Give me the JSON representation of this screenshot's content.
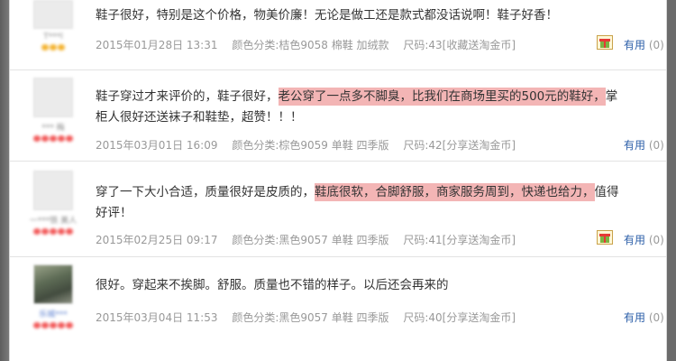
{
  "reviews": [
    {
      "text_parts": [
        "鞋子很好，特别是这个价格，物美价廉！无论是做工还是款式都没话说啊！鞋子好香！"
      ],
      "date": "2015年01月28日 13:31",
      "color": "颜色分类:桔色9058 棉鞋 加绒款",
      "size": "尺码:43[收藏送淘金币]",
      "useful_label": "有用",
      "useful_count": "(0)",
      "has_gift": true
    },
    {
      "text_parts": [
        "鞋子穿过才来评价的，鞋子很好，",
        "老公穿了一点多不脚臭，比我们在商场里买的500元的鞋好，",
        "掌柜人很好还送袜子和鞋垫，超赞！！！"
      ],
      "date": "2015年03月01日 16:09",
      "color": "颜色分类:棕色9059 单鞋 四季版",
      "size": "尺码:42[分享送淘金币]",
      "useful_label": "有用",
      "useful_count": "(0)",
      "has_gift": false
    },
    {
      "text_parts": [
        "穿了一下大小合适，质量很好是皮质的，",
        "鞋底很软，合脚舒服，商家服务周到，快递也给力，",
        "值得好评！"
      ],
      "date": "2015年02月25日 09:17",
      "color": "颜色分类:黑色9057 单鞋 四季版",
      "size": "尺码:41[分享送淘金币]",
      "useful_label": "有用",
      "useful_count": "(0)",
      "has_gift": true
    },
    {
      "text_parts": [
        "很好。穿起来不挨脚。舒服。质量也不错的样子。以后还会再来的"
      ],
      "date": "2015年03月04日 11:53",
      "color": "颜色分类:黑色9057 单鞋 四季版",
      "size": "尺码:40[分享送淘金币]",
      "useful_label": "有用",
      "useful_count": "(0)",
      "has_gift": false
    }
  ],
  "colors": {
    "highlight": "#f3b5b5",
    "useful_link": "#2b5ea8",
    "meta_text": "#999999"
  }
}
